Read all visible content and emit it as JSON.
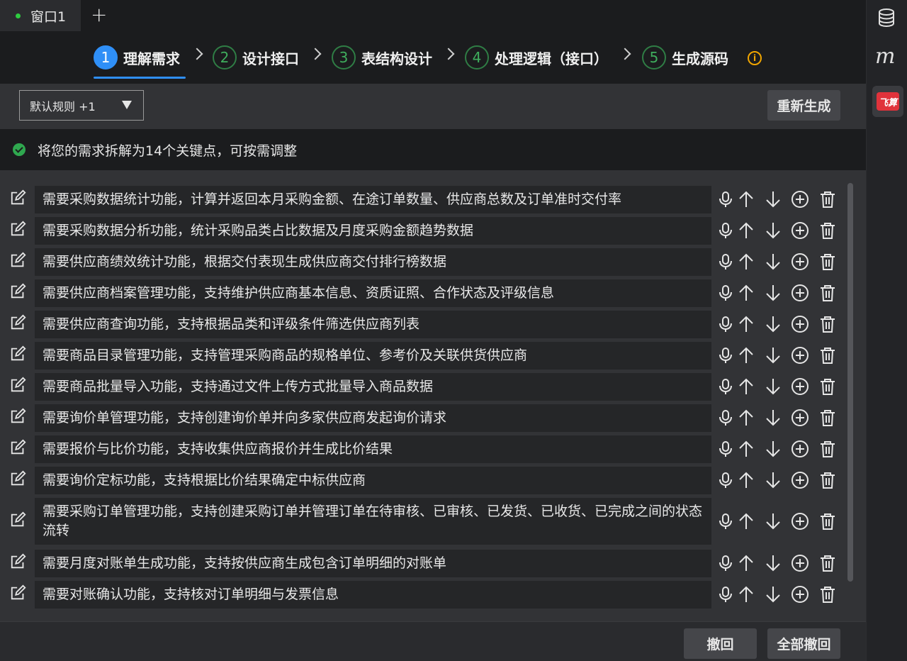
{
  "tab": {
    "label": "窗口1",
    "add_label": "+"
  },
  "steps": [
    {
      "num": "1",
      "label": "理解需求"
    },
    {
      "num": "2",
      "label": "设计接口"
    },
    {
      "num": "3",
      "label": "表结构设计"
    },
    {
      "num": "4",
      "label": "处理逻辑（接口）"
    },
    {
      "num": "5",
      "label": "生成源码"
    }
  ],
  "info_icon": "info-icon",
  "toolbar": {
    "rule_select_value": "默认规则 +1",
    "regenerate_label": "重新生成"
  },
  "summary": {
    "text": "将您的需求拆解为14个关键点，可按需调整"
  },
  "requirements": [
    "需要采购数据统计功能，计算并返回本月采购金额、在途订单数量、供应商总数及订单准时交付率",
    "需要采购数据分析功能，统计采购品类占比数据及月度采购金额趋势数据",
    "需要供应商绩效统计功能，根据交付表现生成供应商交付排行榜数据",
    "需要供应商档案管理功能，支持维护供应商基本信息、资质证照、合作状态及评级信息",
    "需要供应商查询功能，支持根据品类和评级条件筛选供应商列表",
    "需要商品目录管理功能，支持管理采购商品的规格单位、参考价及关联供货供应商",
    "需要商品批量导入功能，支持通过文件上传方式批量导入商品数据",
    "需要询价单管理功能，支持创建询价单并向多家供应商发起询价请求",
    "需要报价与比价功能，支持收集供应商报价并生成比价结果",
    "需要询价定标功能，支持根据比价结果确定中标供应商",
    "需要采购订单管理功能，支持创建采购订单并管理订单在待审核、已审核、已发货、已收货、已完成之间的状态流转",
    "需要月度对账单生成功能，支持按供应商生成包含订单明细的对账单",
    "需要对账确认功能，支持核对订单明细与发票信息"
  ],
  "bottom": {
    "undo_label": "撤回",
    "undo_all_label": "全部撤回"
  },
  "rightbar": {
    "m_label": "m",
    "feisuan_label": "飞算"
  },
  "colors": {
    "accent": "#2f8ff7",
    "step_done": "#3fae5d",
    "success": "#2fa84f",
    "warning": "#f0a500",
    "brand_red": "#e0323b"
  }
}
